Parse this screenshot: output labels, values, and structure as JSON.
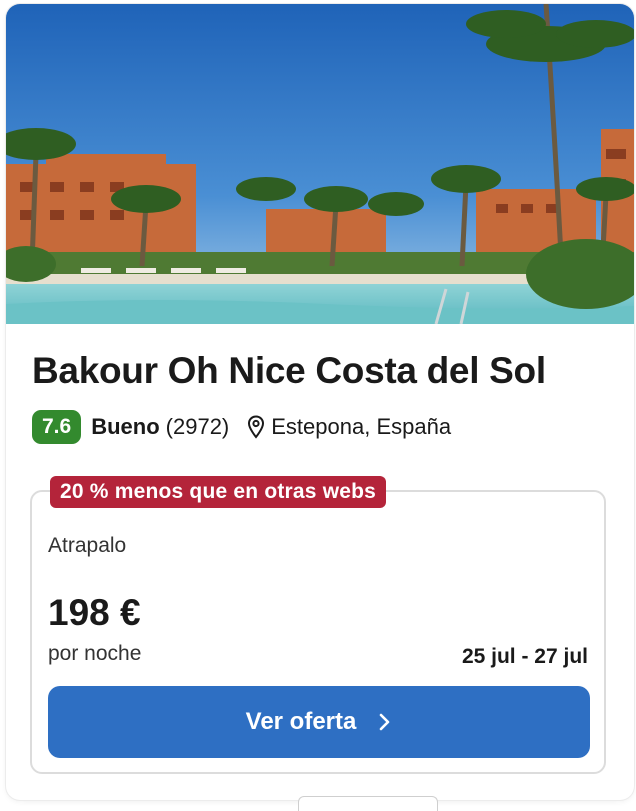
{
  "hotel": {
    "name": "Bakour Oh Nice Costa del Sol",
    "score": "7.6",
    "rating_label": "Bueno",
    "review_count": "(2972)",
    "location": "Estepona, España",
    "photo_icon": "hotel-photo"
  },
  "offer": {
    "discount_badge": "20 % menos que en otras webs",
    "provider": "Atrapalo",
    "price": "198 €",
    "price_unit": "por noche",
    "dates": "25 jul - 27 jul",
    "cta_label": "Ver oferta",
    "cta_icon": "chevron-right-icon"
  },
  "colors": {
    "score_badge": "#338a2e",
    "discount_badge": "#b4243a",
    "cta_button": "#2e6fc3"
  }
}
